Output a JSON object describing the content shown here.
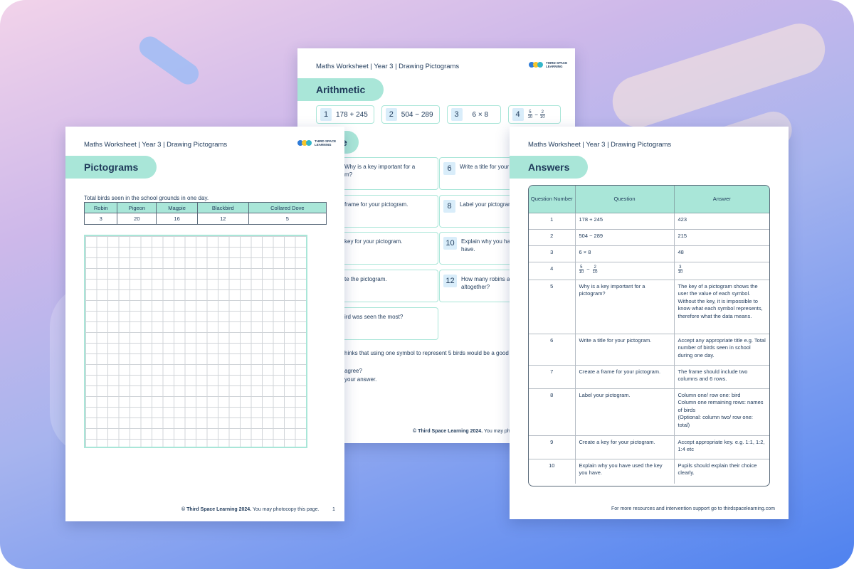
{
  "header_text": "Maths Worksheet | Year 3 | Drawing Pictograms",
  "logo_text": [
    "THIRD SPACE",
    "LEARNING"
  ],
  "back_sheet": {
    "tab": "Arithmetic",
    "arithmetic": [
      {
        "num": "1",
        "text": "178 + 245"
      },
      {
        "num": "2",
        "text": "504 − 289"
      },
      {
        "num": "3",
        "text": "6 × 8"
      },
      {
        "num": "4",
        "frac_a_top": "5",
        "frac_a_bot": "10",
        "op": "−",
        "frac_b_top": "2",
        "frac_b_bot": "10"
      }
    ],
    "section_tab_visible": "e",
    "questions_left": [
      "Why is a key important for a",
      "m?",
      "frame for your pictogram.",
      "key for your pictogram.",
      "te the pictogram.",
      "ird was seen the most?"
    ],
    "questions_right": [
      {
        "num": "6",
        "text": "Write a title for your pi"
      },
      {
        "num": "8",
        "text": "Label your pictogram."
      },
      {
        "num": "10",
        "text": "Explain why you have",
        "text2": "have."
      },
      {
        "num": "12",
        "text": "How many robins and",
        "text2": "altogether?"
      }
    ],
    "bottom_lines": [
      "hinks that using one symbol to represent 5 birds would be a good ke",
      "agree?",
      "your answer."
    ],
    "footer_bold": "© Third Space Learning 2024.",
    "footer_rest": "You may ph"
  },
  "left_sheet": {
    "tab": "Pictograms",
    "caption": "Total birds seen in the school grounds in one day.",
    "birds": [
      {
        "name": "Robin",
        "count": "3"
      },
      {
        "name": "Pigeon",
        "count": "20"
      },
      {
        "name": "Magpie",
        "count": "16"
      },
      {
        "name": "Blackbird",
        "count": "12"
      },
      {
        "name": "Collared Dove",
        "count": "5"
      }
    ],
    "footer_bold": "© Third Space Learning 2024.",
    "footer_rest": "You may photocopy this page.",
    "page_number": "1"
  },
  "right_sheet": {
    "tab": "Answers",
    "columns": [
      "Question Number",
      "Question",
      "Answer"
    ],
    "rows": [
      {
        "n": "1",
        "q": "178 + 245",
        "a": "423"
      },
      {
        "n": "2",
        "q": "504 − 289",
        "a": "215"
      },
      {
        "n": "3",
        "q": "6 × 8",
        "a": "48"
      },
      {
        "n": "4",
        "q": "",
        "a": ""
      },
      {
        "n": "5",
        "q": "Why is a key important for a pictogram?",
        "a": "The key of a pictogram shows the user the value of each symbol. Without the key, it is impossible to know what each symbol represents, therefore what the data means."
      },
      {
        "n": "6",
        "q": "Write a title for your pictogram.",
        "a": "Accept any appropriate title e.g. Total number of birds seen in school during one day."
      },
      {
        "n": "7",
        "q": "Create a frame for your pictogram.",
        "a": "The frame should include two columns and 6 rows."
      },
      {
        "n": "8",
        "q": "Label your pictogram.",
        "a": "Column one/ row one: bird\nColumn one remaining rows: names of birds\n(Optional: column two/ row one: total)"
      },
      {
        "n": "9",
        "q": "Create a key for your pictogram.",
        "a": "Accept appropriate key. e.g. 1:1, 1:2, 1:4 etc"
      },
      {
        "n": "10",
        "q": "Explain why you have used the key you have.",
        "a": "Pupils should explain their choice clearly."
      }
    ],
    "row4_q": {
      "a_top": "5",
      "a_bot": "10",
      "op": "−",
      "b_top": "2",
      "b_bot": "10"
    },
    "row4_a": {
      "top": "3",
      "bot": "10"
    },
    "footer": "For more resources and intervention support go to thirdspacelearning.com"
  }
}
